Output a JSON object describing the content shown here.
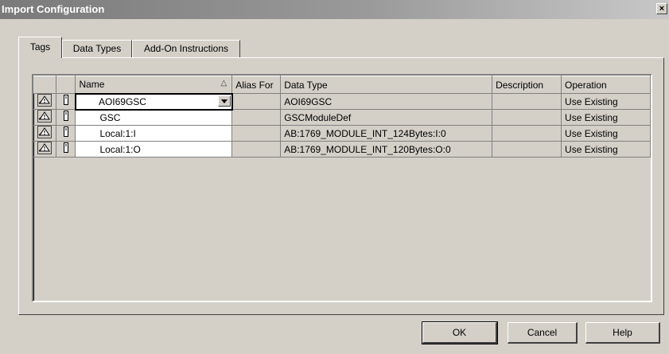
{
  "window": {
    "title": "Import Configuration",
    "close_glyph": "×"
  },
  "tabs": [
    {
      "label": "Tags",
      "active": true
    },
    {
      "label": "Data Types",
      "active": false
    },
    {
      "label": "Add-On Instructions",
      "active": false
    }
  ],
  "grid": {
    "columns": [
      "",
      "",
      "Name",
      "Alias For",
      "Data Type",
      "Description",
      "Operation"
    ],
    "sort_indicator": "△",
    "rows": [
      {
        "icon": "warning-link-icon",
        "icon2": "tag-icon",
        "name": "AOI69GSC",
        "alias_for": "",
        "data_type": "AOI69GSC",
        "description": "",
        "operation": "Use Existing"
      },
      {
        "icon": "warning-link-icon",
        "icon2": "tag-icon",
        "name": "GSC",
        "alias_for": "",
        "data_type": "GSCModuleDef",
        "description": "",
        "operation": "Use Existing"
      },
      {
        "icon": "warning-link-icon",
        "icon2": "tag-icon",
        "name": "Local:1:I",
        "alias_for": "",
        "data_type": "AB:1769_MODULE_INT_124Bytes:I:0",
        "description": "",
        "operation": "Use Existing"
      },
      {
        "icon": "warning-link-icon",
        "icon2": "tag-icon",
        "name": "Local:1:O",
        "alias_for": "",
        "data_type": "AB:1769_MODULE_INT_120Bytes:O:0",
        "description": "",
        "operation": "Use Existing"
      }
    ]
  },
  "buttons": {
    "ok": "OK",
    "cancel": "Cancel",
    "help": "Help"
  }
}
